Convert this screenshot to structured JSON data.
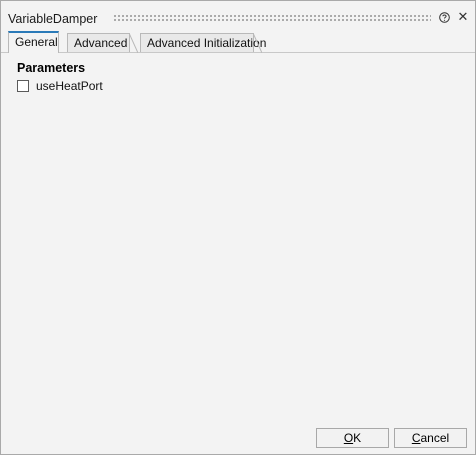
{
  "dialog": {
    "title": "VariableDamper",
    "help_icon": "help-circle-icon",
    "close_icon": "close-icon"
  },
  "tabs": [
    {
      "label": "General",
      "active": true
    },
    {
      "label": "Advanced",
      "active": false
    },
    {
      "label": "Advanced Initialization",
      "active": false
    }
  ],
  "general": {
    "section_title": "Parameters",
    "use_heat_port": {
      "label": "useHeatPort",
      "checked": false
    }
  },
  "buttons": {
    "ok": {
      "mnemonic": "O",
      "rest": "K"
    },
    "cancel": {
      "mnemonic": "C",
      "rest": "ancel"
    }
  },
  "colors": {
    "accent": "#2a7ab8",
    "background": "#f3f3f3"
  }
}
